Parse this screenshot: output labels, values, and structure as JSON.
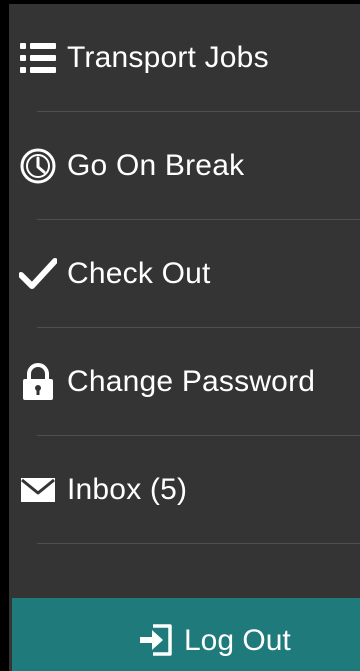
{
  "colors": {
    "drawer_background": "#343434",
    "divider": "#4f4f4f",
    "text": "#ffffff",
    "logout_background": "#1f7a7c"
  },
  "menu": {
    "items": [
      {
        "icon": "list-icon",
        "label": "Transport Jobs"
      },
      {
        "icon": "clock-icon",
        "label": "Go On Break"
      },
      {
        "icon": "checkmark-icon",
        "label": "Check Out"
      },
      {
        "icon": "lock-icon",
        "label": "Change Password"
      },
      {
        "icon": "envelope-icon",
        "label": "Inbox (5)"
      }
    ]
  },
  "logout": {
    "icon": "logout-icon",
    "label": "Log Out"
  }
}
